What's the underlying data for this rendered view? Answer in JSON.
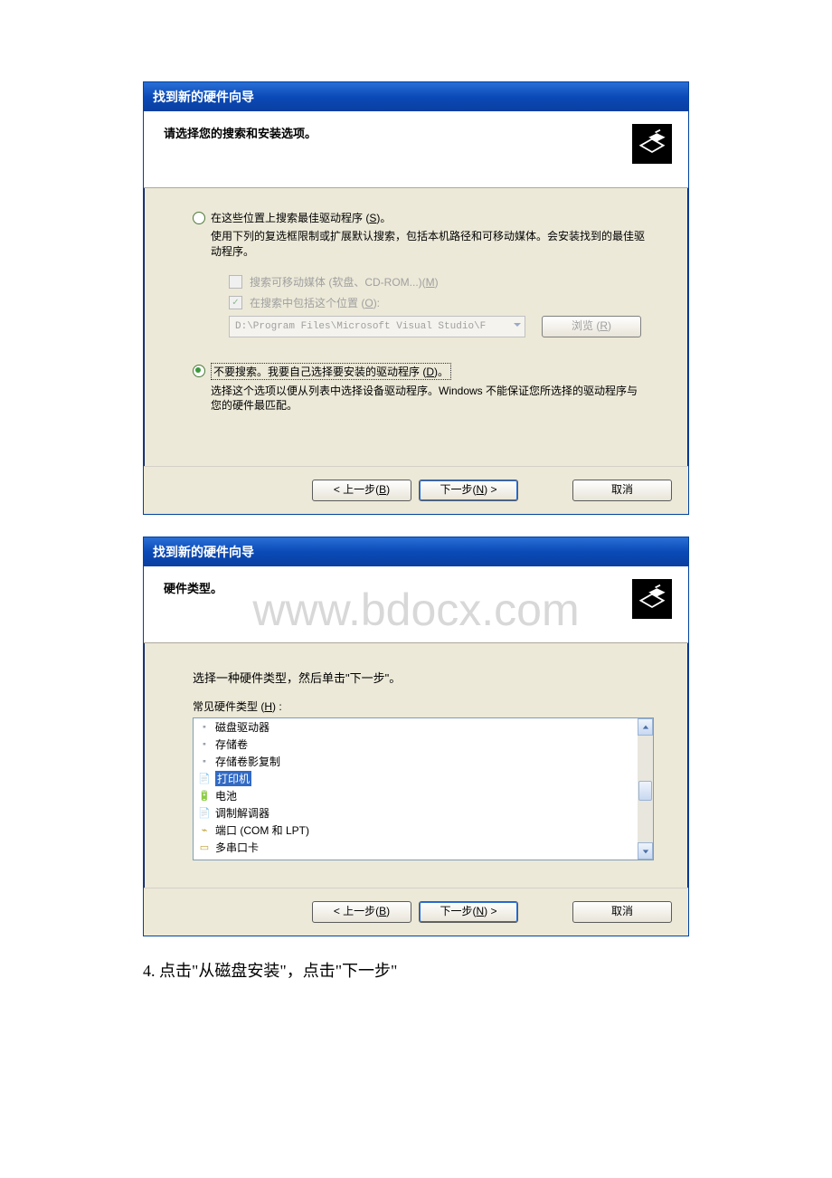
{
  "watermark": "www.bdocx.com",
  "dialog1": {
    "title": "找到新的硬件向导",
    "header": "请选择您的搜索和安装选项。",
    "opt1": {
      "label_pre": "在这些位置上搜索最佳驱动程序 (",
      "accel": "S",
      "label_post": ")。",
      "desc": "使用下列的复选框限制或扩展默认搜索，包括本机路径和可移动媒体。会安装找到的最佳驱动程序。"
    },
    "chk1": {
      "label_pre": "搜索可移动媒体 (软盘、CD-ROM...)(",
      "accel": "M",
      "label_post": ")"
    },
    "chk2": {
      "label_pre": "在搜索中包括这个位置 (",
      "accel": "O",
      "label_post": "):"
    },
    "path": "D:\\Program Files\\Microsoft Visual Studio\\F",
    "browse_pre": "浏览 (",
    "browse_accel": "R",
    "browse_post": ")",
    "opt2": {
      "label_pre": "不要搜索。我要自己选择要安装的驱动程序 (",
      "accel": "D",
      "label_post": ")。",
      "desc": "选择这个选项以便从列表中选择设备驱动程序。Windows 不能保证您所选择的驱动程序与您的硬件最匹配。"
    },
    "back_pre": "< 上一步(",
    "back_accel": "B",
    "back_post": ")",
    "next_pre": "下一步(",
    "next_accel": "N",
    "next_post": ") >",
    "cancel": "取消"
  },
  "dialog2": {
    "title": "找到新的硬件向导",
    "header": "硬件类型。",
    "instruction": "选择一种硬件类型，然后单击\"下一步\"。",
    "list_label_pre": "常见硬件类型 (",
    "list_label_accel": "H",
    "list_label_post": ") :",
    "items": [
      {
        "label": "磁盘驱动器",
        "icon": "🞍"
      },
      {
        "label": "存储卷",
        "icon": "🞍"
      },
      {
        "label": "存储卷影复制",
        "icon": "🞍"
      },
      {
        "label": "打印机",
        "icon": "📄"
      },
      {
        "label": "电池",
        "icon": "🔋"
      },
      {
        "label": "调制解调器",
        "icon": "📄"
      },
      {
        "label": "端口 (COM 和 LPT)",
        "icon": "⌁"
      },
      {
        "label": "多串口卡",
        "icon": "▭"
      }
    ],
    "selected_index": 3,
    "back_pre": "< 上一步(",
    "back_accel": "B",
    "back_post": ")",
    "next_pre": "下一步(",
    "next_accel": "N",
    "next_post": ") >",
    "cancel": "取消"
  },
  "step_text": "4. 点击\"从磁盘安装\"，点击\"下一步\""
}
